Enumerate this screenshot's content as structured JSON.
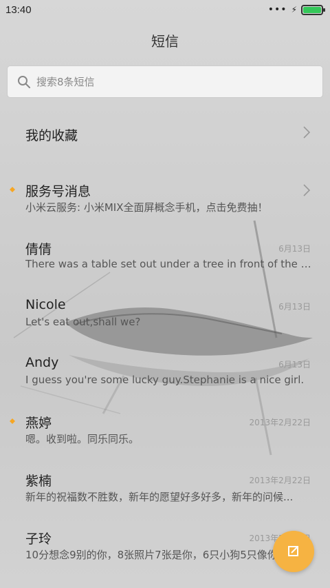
{
  "status": {
    "time": "13:40",
    "dots": "•••",
    "bolt": "⚡",
    "battery_level": 1.0,
    "battery_color": "#34c759"
  },
  "header": {
    "title": "短信"
  },
  "search": {
    "placeholder": "搜索8条短信",
    "icon": "search-icon"
  },
  "favorites": {
    "label": "我的收藏"
  },
  "conversations": [
    {
      "name": "服务号消息",
      "preview": "小米云服务: 小米MIX全面屏概念手机，点击免费抽！",
      "time": "",
      "unread": true
    },
    {
      "name": "倩倩",
      "preview": "There was a table set out under a tree in front of the ho...",
      "time": "6月13日",
      "unread": false
    },
    {
      "name": "Nicole",
      "preview": "Let's eat out,shall we?",
      "time": "6月13日",
      "unread": false
    },
    {
      "name": "Andy",
      "preview": "I guess you're some lucky guy.Stephanie is a nice girl.",
      "time": "6月13日",
      "unread": false
    },
    {
      "name": "燕婷",
      "preview": "嗯。收到啦。同乐同乐。",
      "time": "2013年2月22日",
      "unread": true
    },
    {
      "name": "紫楠",
      "preview": "新年的祝福数不胜数，新年的愿望好多好多，新年的问候...",
      "time": "2013年2月22日",
      "unread": false
    },
    {
      "name": "子玲",
      "preview": "10分想念9别的你，8张照片7张是你，6只小狗5只像你...",
      "time": "2013年2月22日",
      "unread": false
    }
  ],
  "colors": {
    "accent": "#f6b342",
    "unread_dot": "#f6a623"
  },
  "compose_icon": "compose-icon"
}
